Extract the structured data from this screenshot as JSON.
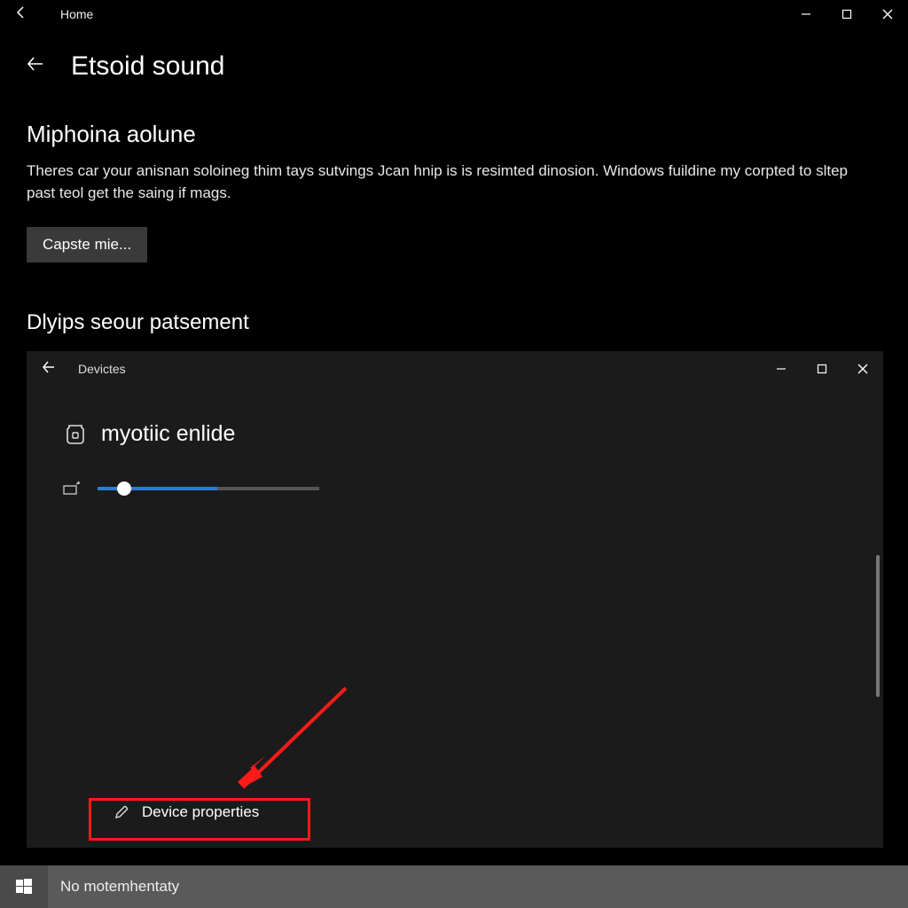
{
  "outer": {
    "home_label": "Home",
    "page_title": "Etsoid sound",
    "section1_title": "Miphoina aolune",
    "section1_desc": "Theres car your anisnan soloineg thim tays sutvings Jcan hnip is is resimted dinosion. Windows fuildine my corpted to sltep past teol get the saing if mags.",
    "button_label": "Capste mie...",
    "section2_title": "Dlyips seour patsement"
  },
  "inner": {
    "breadcrumb": "Devictes",
    "device_name": "myotiic enlide",
    "slider_percent": 12,
    "slider_fill_percent": 54,
    "device_properties_label": "Device properties"
  },
  "taskbar": {
    "search_text": "No motemhentaty"
  },
  "colors": {
    "accent": "#2e7bd6",
    "annotation": "#ff1a1a",
    "inner_bg": "#1b1b1b",
    "button_bg": "#3a3a3a"
  }
}
